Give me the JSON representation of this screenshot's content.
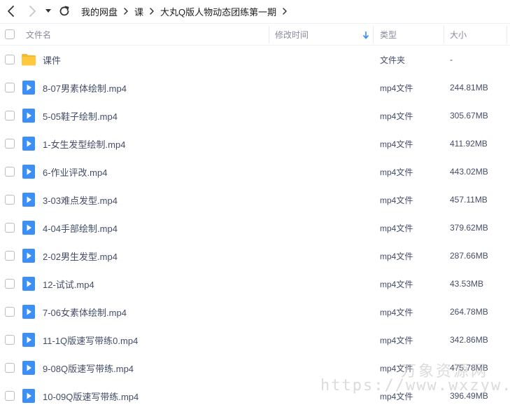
{
  "breadcrumbs": [
    "我的网盘",
    "课",
    "大丸Q版人物动态团练第一期"
  ],
  "columns": {
    "name": "文件名",
    "modified": "修改时间",
    "type": "类型",
    "size": "大小"
  },
  "files": [
    {
      "name": "课件",
      "type": "文件夹",
      "size": "-",
      "icon": "folder-icon"
    },
    {
      "name": "8-07男素体绘制.mp4",
      "type": "mp4文件",
      "size": "244.81MB",
      "icon": "video-file-icon"
    },
    {
      "name": "5-05鞋子绘制.mp4",
      "type": "mp4文件",
      "size": "305.67MB",
      "icon": "video-file-icon"
    },
    {
      "name": "1-女生发型绘制.mp4",
      "type": "mp4文件",
      "size": "411.92MB",
      "icon": "video-file-icon"
    },
    {
      "name": "6-作业评改.mp4",
      "type": "mp4文件",
      "size": "443.02MB",
      "icon": "video-file-icon"
    },
    {
      "name": "3-03难点发型.mp4",
      "type": "mp4文件",
      "size": "457.11MB",
      "icon": "video-file-icon"
    },
    {
      "name": "4-04手部绘制.mp4",
      "type": "mp4文件",
      "size": "379.62MB",
      "icon": "video-file-icon"
    },
    {
      "name": "2-02男生发型.mp4",
      "type": "mp4文件",
      "size": "287.66MB",
      "icon": "video-file-icon"
    },
    {
      "name": "12-试试.mp4",
      "type": "mp4文件",
      "size": "43.53MB",
      "icon": "video-file-icon"
    },
    {
      "name": "7-06女素体绘制.mp4",
      "type": "mp4文件",
      "size": "264.78MB",
      "icon": "video-file-icon"
    },
    {
      "name": "11-1Q版速写带练0.mp4",
      "type": "mp4文件",
      "size": "342.86MB",
      "icon": "video-file-icon"
    },
    {
      "name": "9-08Q版速写带练.mp4",
      "type": "mp4文件",
      "size": "475.78MB",
      "icon": "video-file-icon"
    },
    {
      "name": "10-09Q版速写带练.mp4",
      "type": "mp4文件",
      "size": "396.49MB",
      "icon": "video-file-icon"
    }
  ],
  "watermark": {
    "brand": "万象资源网",
    "url": "https://www.wxzyw.cn"
  },
  "colors": {
    "accent": "#2f89f4",
    "folder": "#ffc83d",
    "text": "#424e67",
    "header_text": "#878c9c"
  }
}
